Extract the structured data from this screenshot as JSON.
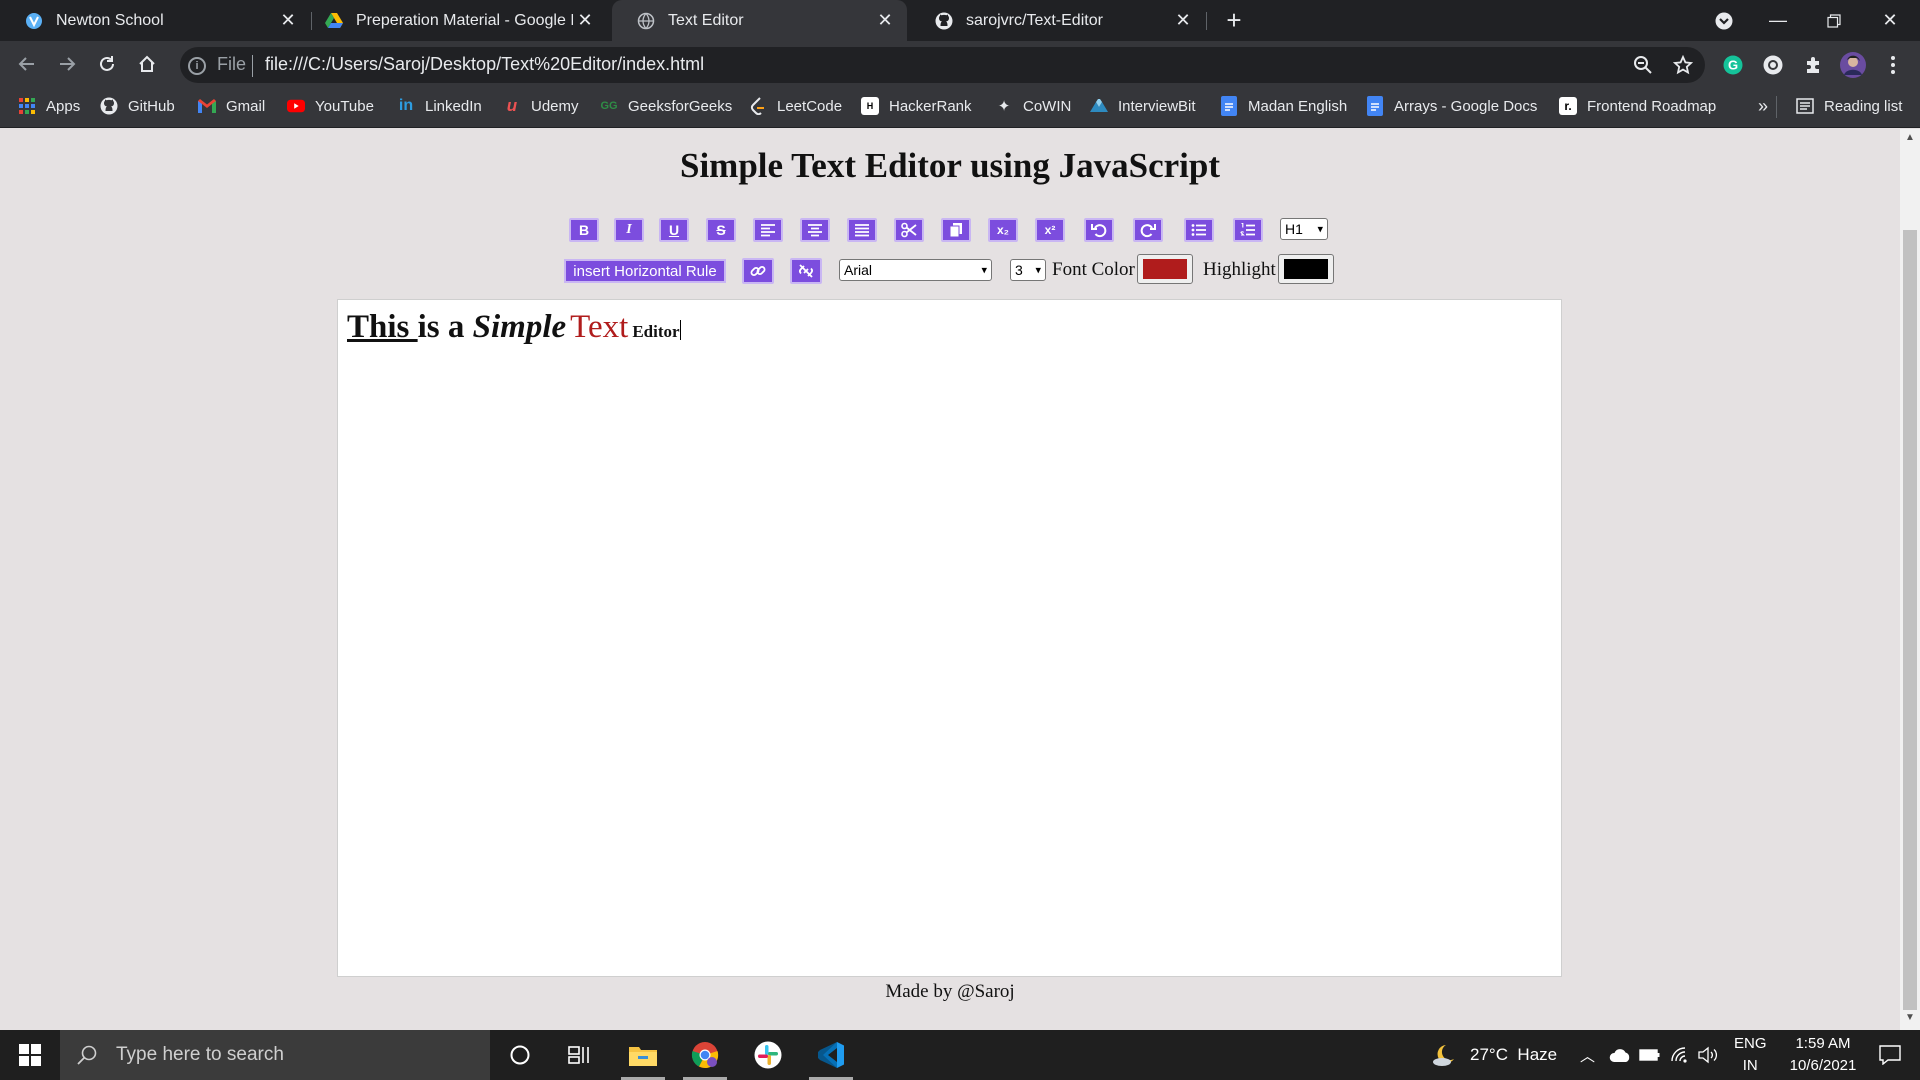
{
  "browser": {
    "tabs": [
      {
        "title": "Newton School",
        "icon": "newton-school-icon"
      },
      {
        "title": "Preperation Material - Google Dr",
        "icon": "google-drive-icon"
      },
      {
        "title": "Text Editor",
        "icon": "globe-icon",
        "active": true
      },
      {
        "title": "sarojvrc/Text-Editor",
        "icon": "github-icon"
      }
    ],
    "address": {
      "scheme_label": "File",
      "url": "file:///C:/Users/Saroj/Desktop/Text%20Editor/index.html"
    },
    "bookmarks": [
      {
        "label": "Apps",
        "icon": "apps-grid-icon"
      },
      {
        "label": "GitHub",
        "icon": "github-icon"
      },
      {
        "label": "Gmail",
        "icon": "gmail-icon"
      },
      {
        "label": "YouTube",
        "icon": "youtube-icon"
      },
      {
        "label": "LinkedIn",
        "icon": "linkedin-icon"
      },
      {
        "label": "Udemy",
        "icon": "udemy-icon"
      },
      {
        "label": "GeeksforGeeks",
        "icon": "geeksforgeeks-icon"
      },
      {
        "label": "LeetCode",
        "icon": "leetcode-icon"
      },
      {
        "label": "HackerRank",
        "icon": "hackerrank-icon"
      },
      {
        "label": "CoWIN",
        "icon": "cowin-icon"
      },
      {
        "label": "InterviewBit",
        "icon": "interviewbit-icon"
      },
      {
        "label": "Madan English",
        "icon": "google-docs-icon"
      },
      {
        "label": "Arrays - Google Docs",
        "icon": "google-docs-icon"
      },
      {
        "label": "Frontend Roadmap",
        "icon": "roadmap-icon"
      }
    ],
    "overflow_label": "»",
    "reading_list_label": "Reading list"
  },
  "page": {
    "title": "Simple Text Editor using JavaScript",
    "toolbar_row1": [
      {
        "name": "bold-button",
        "glyph": "B"
      },
      {
        "name": "italic-button",
        "glyph": "I"
      },
      {
        "name": "underline-button",
        "glyph": "U"
      },
      {
        "name": "strikethrough-button",
        "glyph": "S"
      },
      {
        "name": "align-left-button",
        "glyph": "align-left"
      },
      {
        "name": "align-center-button",
        "glyph": "align-center"
      },
      {
        "name": "justify-button",
        "glyph": "justify"
      },
      {
        "name": "cut-button",
        "glyph": "scissors"
      },
      {
        "name": "copy-button",
        "glyph": "copy"
      },
      {
        "name": "subscript-button",
        "glyph": "x₂"
      },
      {
        "name": "superscript-button",
        "glyph": "x²"
      },
      {
        "name": "undo-button",
        "glyph": "undo"
      },
      {
        "name": "redo-button",
        "glyph": "redo"
      },
      {
        "name": "unordered-list-button",
        "glyph": "list-ul"
      },
      {
        "name": "ordered-list-button",
        "glyph": "list-ol"
      }
    ],
    "heading_select": "H1",
    "hr_button": "insert Horizontal Rule",
    "font_select": "Arial",
    "size_select": "3",
    "font_color_label": "Font Color",
    "font_color": "#b01c1c",
    "highlight_label": "Highlight",
    "highlight_color": "#000000",
    "editor_content": {
      "w1": "This ",
      "w2": "is a ",
      "w3": "Simple",
      "w4": "Text",
      "w5": "Editor"
    },
    "footer": "Made by @Saroj",
    "accent_color": "#7c4dde"
  },
  "taskbar": {
    "search_placeholder": "Type here to search",
    "weather": "27°C  Haze",
    "lang_top": "ENG",
    "lang_bottom": "IN",
    "time": "1:59 AM",
    "date": "10/6/2021"
  }
}
